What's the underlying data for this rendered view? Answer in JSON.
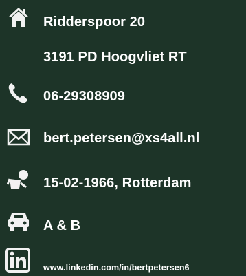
{
  "contact": {
    "address_line1": "Ridderspoor 20",
    "address_line2": "3191 PD  Hoogvliet RT",
    "phone": "06-29308909",
    "email": "bert.petersen@xs4all.nl",
    "birth": "15-02-1966, Rotterdam",
    "license": "A  &  B",
    "linkedin": "www.linkedin.com/in/bertpetersen6"
  },
  "icons": {
    "address": "home-icon",
    "phone": "phone-icon",
    "email": "envelope-icon",
    "birth": "baby-icon",
    "license": "car-icon",
    "linkedin": "linkedin-icon"
  },
  "colors": {
    "background": "#1d3428",
    "text": "#ffffff",
    "icon": "#f2f2f2"
  }
}
